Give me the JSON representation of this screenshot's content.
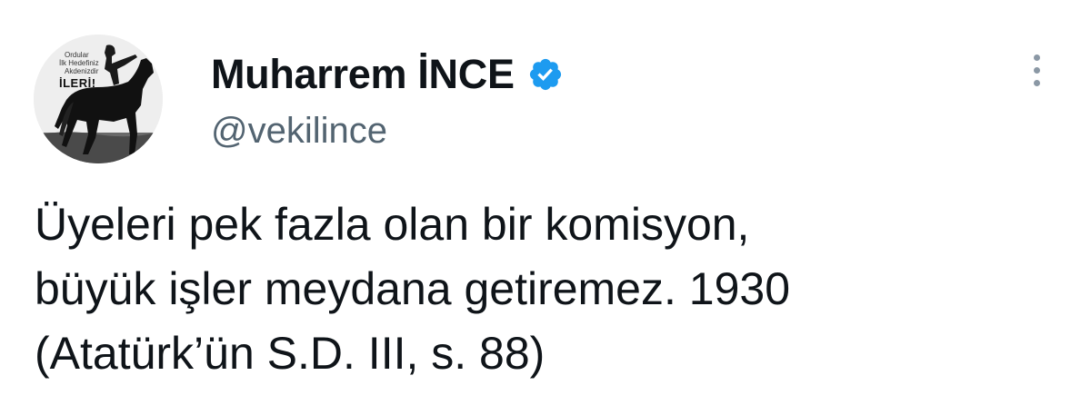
{
  "author": {
    "display_name": "Muharrem İNCE",
    "handle": "@vekilince",
    "verified": true,
    "avatar": {
      "caption_lines": [
        "Ordular",
        "İlk Hedefiniz",
        "Akdenizdir"
      ],
      "caption_big": "İLERİ!"
    }
  },
  "tweet": {
    "text_lines": [
      "Üyeleri pek fazla olan bir komisyon,",
      "büyük işler meydana getiremez. 1930",
      "(Atatürk’ün S.D. III, s. 88)"
    ]
  },
  "colors": {
    "verified_badge": "#1d9bf0",
    "handle": "#536471",
    "text": "#0f1419",
    "more_dots": "#8b98a5"
  },
  "icons": {
    "verified": "verified-badge-icon",
    "more": "more-options-icon"
  }
}
